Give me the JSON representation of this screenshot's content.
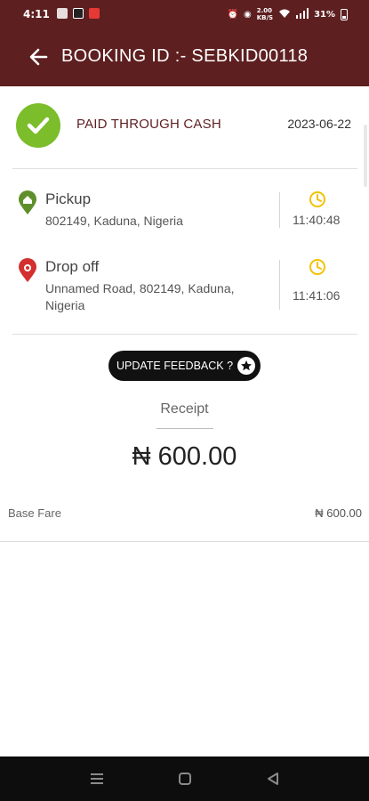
{
  "status_bar": {
    "time": "4:11",
    "speed": "2.00",
    "speed_unit": "KB/S",
    "battery": "31%"
  },
  "header": {
    "title": "BOOKING ID :- SEBKID00118"
  },
  "payment": {
    "label": "PAID THROUGH CASH",
    "date": "2023-06-22"
  },
  "pickup": {
    "title": "Pickup",
    "address": "802149, Kaduna, Nigeria",
    "time": "11:40:48"
  },
  "dropoff": {
    "title": "Drop off",
    "address": "Unnamed Road, 802149, Kaduna, Nigeria",
    "time": "11:41:06"
  },
  "feedback_button": {
    "label": "UPDATE FEEDBACK ?"
  },
  "receipt": {
    "label": "Receipt",
    "total": "₦ 600.00",
    "lines": [
      {
        "label": "Base Fare",
        "value": "₦ 600.00"
      }
    ]
  },
  "colors": {
    "header_bg": "#5e1f20",
    "paid_green": "#7bbd2a",
    "pickup_pin": "#5f8f2a",
    "dropoff_pin": "#d32f2f",
    "clock_yellow": "#f2c200"
  }
}
